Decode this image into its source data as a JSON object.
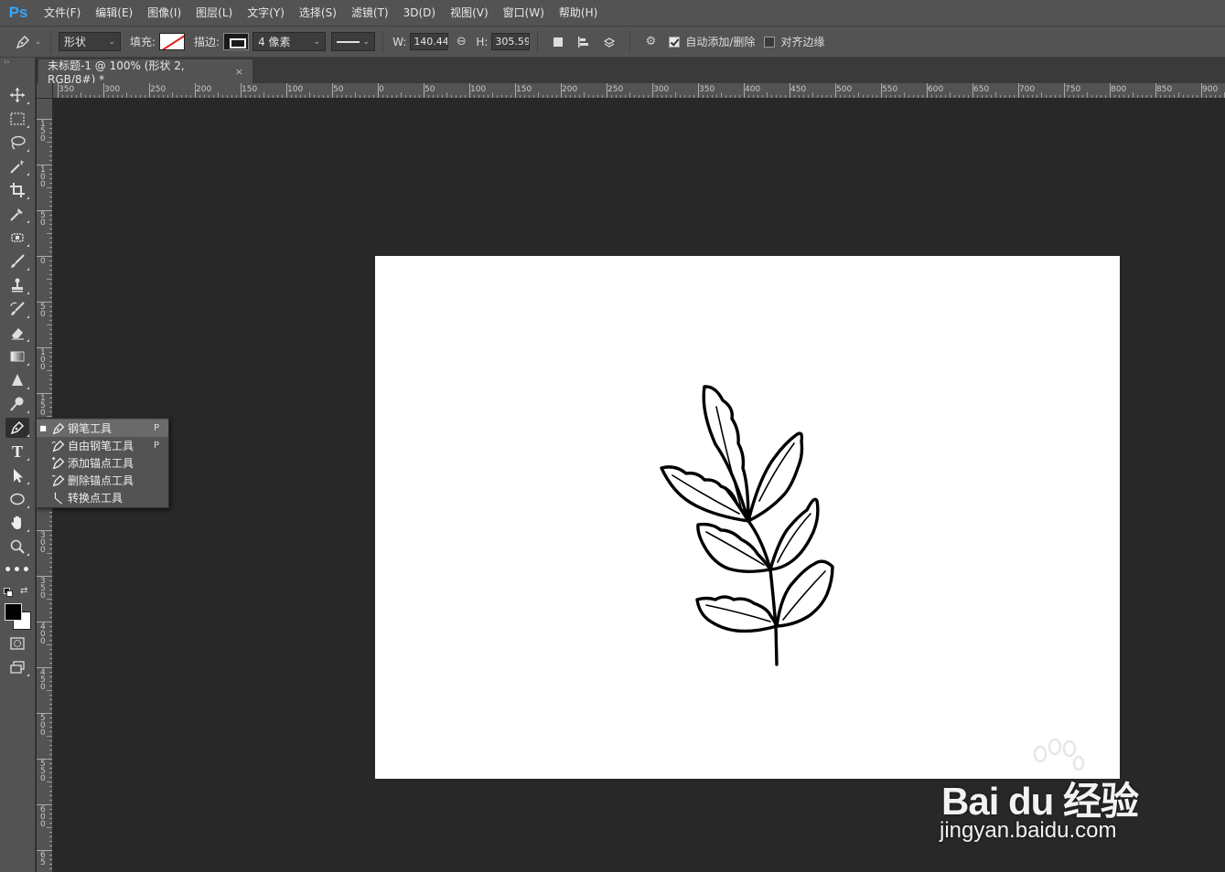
{
  "app": {
    "logo": "Ps"
  },
  "menu": [
    "文件(F)",
    "编辑(E)",
    "图像(I)",
    "图层(L)",
    "文字(Y)",
    "选择(S)",
    "滤镜(T)",
    "3D(D)",
    "视图(V)",
    "窗口(W)",
    "帮助(H)"
  ],
  "options": {
    "mode": "形状",
    "fill_label": "填充:",
    "stroke_label": "描边:",
    "stroke_width": "4 像素",
    "w_label": "W:",
    "w_value": "140.44 |",
    "h_label": "H:",
    "h_value": "305.59 |",
    "auto_add_delete": "自动添加/删除",
    "auto_add_delete_checked": true,
    "align_edges": "对齐边缘",
    "align_edges_checked": false
  },
  "document": {
    "tab_title": "未标题-1 @ 100% (形状 2, RGB/8#) *",
    "close": "×"
  },
  "ruler_h": [
    "350",
    "300",
    "250",
    "200",
    "150",
    "100",
    "50",
    "0",
    "50",
    "100",
    "150",
    "200",
    "250",
    "300",
    "350",
    "400",
    "450",
    "500",
    "550",
    "600",
    "650",
    "700",
    "750",
    "800",
    "850",
    "900"
  ],
  "ruler_v": [
    "150",
    "100",
    "50",
    "0",
    "50",
    "100",
    "150",
    "200",
    "250",
    "300",
    "350",
    "400",
    "450",
    "500",
    "550",
    "600",
    "65"
  ],
  "flyout": {
    "items": [
      {
        "label": "钢笔工具",
        "key": "P",
        "active": true
      },
      {
        "label": "自由钢笔工具",
        "key": "P",
        "active": false
      },
      {
        "label": "添加锚点工具",
        "key": "",
        "active": false
      },
      {
        "label": "删除锚点工具",
        "key": "",
        "active": false
      },
      {
        "label": "转换点工具",
        "key": "",
        "active": false
      }
    ]
  },
  "watermark": {
    "brand": "Bai du 经验",
    "url": "jingyan.baidu.com"
  },
  "colors": {
    "accent": "#31a8ff",
    "panel": "#535353",
    "workspace": "#282828"
  }
}
